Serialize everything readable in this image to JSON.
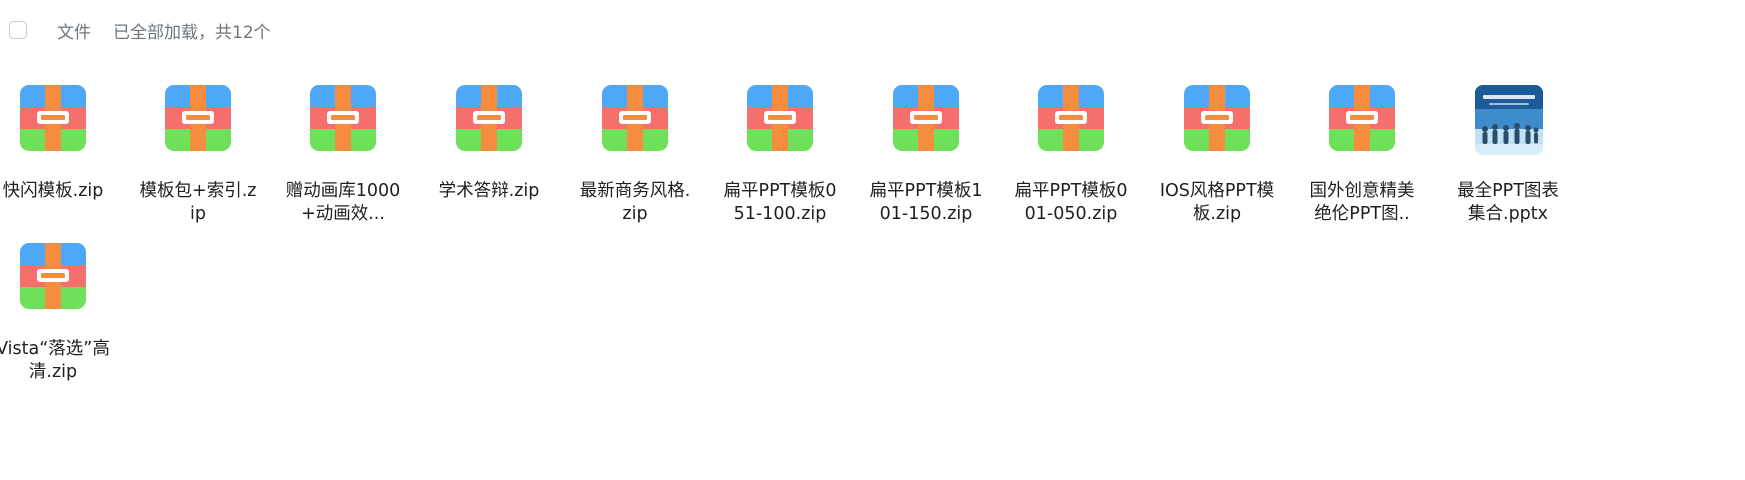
{
  "header": {
    "label": "文件",
    "status": "已全部加载，共12个"
  },
  "files": [
    {
      "name": "快闪模板.zip",
      "type": "zip"
    },
    {
      "name": "模板包+索引.zip",
      "type": "zip"
    },
    {
      "name": "赠动画库1000+动画效...",
      "type": "zip"
    },
    {
      "name": "学术答辩.zip",
      "type": "zip"
    },
    {
      "name": "最新商务风格.zip",
      "type": "zip"
    },
    {
      "name": "扁平PPT模板051-100.zip",
      "type": "zip"
    },
    {
      "name": "扁平PPT模板101-150.zip",
      "type": "zip"
    },
    {
      "name": "扁平PPT模板001-050.zip",
      "type": "zip"
    },
    {
      "name": "IOS风格PPT模板.zip",
      "type": "zip"
    },
    {
      "name": "国外创意精美绝伦PPT图..",
      "type": "zip"
    },
    {
      "name": "最全PPT图表集合.pptx",
      "type": "pptx"
    },
    {
      "name": "Vista“落选”高清.zip",
      "type": "zip"
    }
  ],
  "icons": {
    "zip": "archive-icon",
    "pptx": "presentation-thumbnail"
  },
  "colors": {
    "archive_top": "#4da8f7",
    "archive_middle": "#f56f6d",
    "archive_bottom": "#6fe05a",
    "archive_strap": "#f68c3d"
  }
}
